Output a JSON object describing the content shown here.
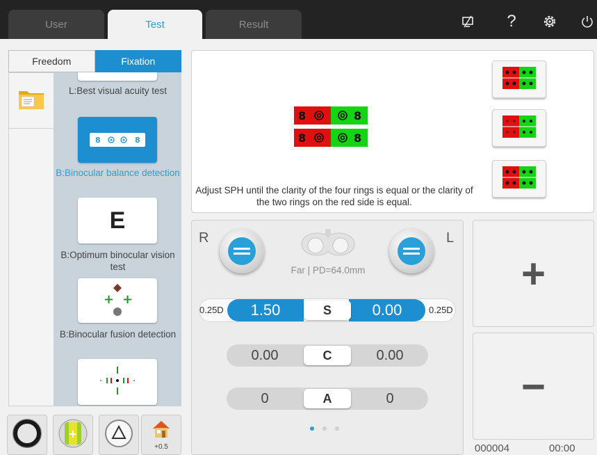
{
  "tabs": [
    {
      "label": "User",
      "active": false
    },
    {
      "label": "Test",
      "active": true
    },
    {
      "label": "Result",
      "active": false
    }
  ],
  "toolbar_icons": [
    "screen-off-icon",
    "help-icon",
    "settings-icon",
    "power-icon"
  ],
  "toolbar": {
    "help_glyph": "?"
  },
  "sidebar": {
    "mode_tabs": [
      {
        "label": "Freedom",
        "active": false
      },
      {
        "label": "Fixation",
        "active": true
      }
    ],
    "tests": [
      {
        "label": "L:Best visual acuity test",
        "selected": false
      },
      {
        "label": "B:Binocular balance detection",
        "selected": true
      },
      {
        "label": "B:Optimum binocular vision test",
        "selected": false
      },
      {
        "label": "B:Binocular fusion detection",
        "selected": false
      }
    ],
    "e_glyph": "E"
  },
  "bottom_buttons": {
    "home_badge": "+0.5"
  },
  "preview": {
    "instruction": "Adjust SPH until the clarity of the four rings is equal or the clarity of the two rings on the red side is equal."
  },
  "control": {
    "right_label": "R",
    "left_label": "L",
    "distance_info": "Far | PD=64.0mm",
    "rows": [
      {
        "key": "S",
        "right": "1.50",
        "left": "0.00",
        "step_left": "0.25D",
        "step_right": "0.25D"
      },
      {
        "key": "C",
        "right": "0.00",
        "left": "0.00"
      },
      {
        "key": "A",
        "right": "0",
        "left": "0"
      }
    ],
    "page_dots": 3,
    "active_dot": 0
  },
  "adjust": {
    "plus": "+",
    "minus": "−"
  },
  "status": {
    "counter": "000004",
    "time": "00:00"
  },
  "colors": {
    "accent": "#2a9fd8",
    "red": "#e01010",
    "green": "#15d415"
  }
}
